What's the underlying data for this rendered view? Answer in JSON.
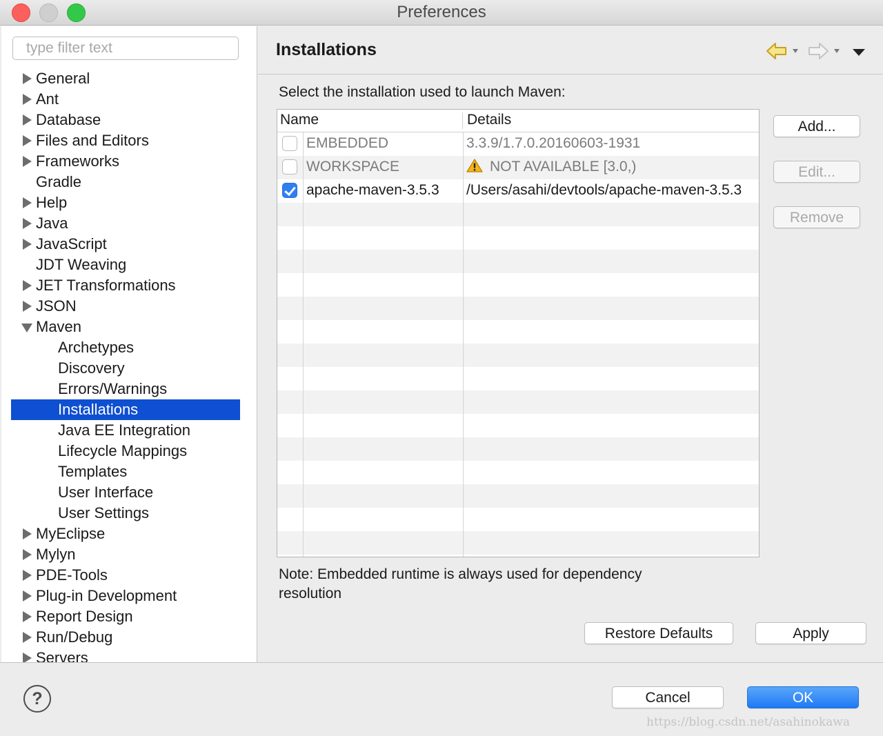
{
  "window": {
    "title": "Preferences"
  },
  "sidebar": {
    "filter_placeholder": "type filter text",
    "items": [
      {
        "label": "General",
        "expandable": true
      },
      {
        "label": "Ant",
        "expandable": true
      },
      {
        "label": "Database",
        "expandable": true
      },
      {
        "label": "Files and Editors",
        "expandable": true
      },
      {
        "label": "Frameworks",
        "expandable": true
      },
      {
        "label": "Gradle",
        "expandable": false
      },
      {
        "label": "Help",
        "expandable": true
      },
      {
        "label": "Java",
        "expandable": true
      },
      {
        "label": "JavaScript",
        "expandable": true
      },
      {
        "label": "JDT Weaving",
        "expandable": false
      },
      {
        "label": "JET Transformations",
        "expandable": true
      },
      {
        "label": "JSON",
        "expandable": true
      },
      {
        "label": "Maven",
        "expandable": true,
        "expanded": true
      },
      {
        "label": "Archetypes",
        "child": true
      },
      {
        "label": "Discovery",
        "child": true
      },
      {
        "label": "Errors/Warnings",
        "child": true
      },
      {
        "label": "Installations",
        "child": true,
        "selected": true
      },
      {
        "label": "Java EE Integration",
        "child": true
      },
      {
        "label": "Lifecycle Mappings",
        "child": true
      },
      {
        "label": "Templates",
        "child": true
      },
      {
        "label": "User Interface",
        "child": true
      },
      {
        "label": "User Settings",
        "child": true
      },
      {
        "label": "MyEclipse",
        "expandable": true
      },
      {
        "label": "Mylyn",
        "expandable": true
      },
      {
        "label": "PDE-Tools",
        "expandable": true
      },
      {
        "label": "Plug-in Development",
        "expandable": true
      },
      {
        "label": "Report Design",
        "expandable": true
      },
      {
        "label": "Run/Debug",
        "expandable": true
      },
      {
        "label": "Servers",
        "expandable": true
      }
    ]
  },
  "page": {
    "title": "Installations",
    "description": "Select the installation used to launch Maven:",
    "columns": [
      "Name",
      "Details"
    ],
    "rows": [
      {
        "name": "EMBEDDED",
        "details": "3.3.9/1.7.0.20160603-1931",
        "checked": false,
        "muted": true,
        "warning": false
      },
      {
        "name": "WORKSPACE",
        "details": "NOT AVAILABLE [3.0,)",
        "checked": false,
        "muted": true,
        "warning": true
      },
      {
        "name": "apache-maven-3.5.3",
        "details": "/Users/asahi/devtools/apache-maven-3.5.3",
        "checked": true,
        "muted": false,
        "warning": false
      }
    ],
    "buttons": {
      "add": "Add...",
      "edit": "Edit...",
      "remove": "Remove",
      "restore": "Restore Defaults",
      "apply": "Apply"
    },
    "note": "Note: Embedded runtime is always used for dependency resolution"
  },
  "footer": {
    "help": "?",
    "cancel": "Cancel",
    "ok": "OK",
    "watermark": "https://blog.csdn.net/asahinokawa"
  },
  "colors": {
    "selection": "#0f4fd1",
    "ok_button": "#1f79f3",
    "checkbox_on": "#2f7ff0",
    "warning": "#f3b51b"
  }
}
